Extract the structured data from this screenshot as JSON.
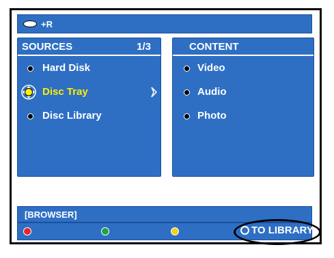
{
  "top_bar": {
    "disc_icon": "disc-oval-icon",
    "disc_type": "+R"
  },
  "sources": {
    "title": "SOURCES",
    "page": "1/3",
    "items": [
      {
        "label": "Hard Disk",
        "selected": false
      },
      {
        "label": "Disc Tray",
        "selected": true
      },
      {
        "label": "Disc Library",
        "selected": false
      }
    ]
  },
  "content": {
    "title": "CONTENT",
    "items": [
      {
        "label": "Video"
      },
      {
        "label": "Audio"
      },
      {
        "label": "Photo"
      }
    ]
  },
  "status_bar": {
    "label": "[BROWSER]"
  },
  "keys": {
    "red": "#e8232a",
    "green": "#1fa33c",
    "yellow": "#f2d11c",
    "blue_label": "TO LIBRARY"
  },
  "colors": {
    "panel": "#2e6fc4",
    "selected_text": "#ffee00",
    "text": "#ffffff"
  }
}
